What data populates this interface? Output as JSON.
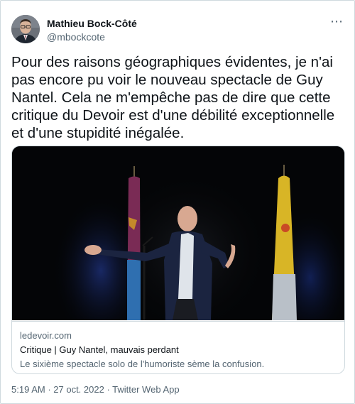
{
  "author": {
    "name": "Mathieu Bock-Côté",
    "handle": "@mbockcote"
  },
  "more_icon": "⋯",
  "tweet_text": "Pour des raisons géographiques évidentes, je n'ai pas encore pu voir le nouveau spectacle de Guy Nantel. Cela ne m'empêche pas de dire que cette critique du Devoir est d'une débilité exceptionnelle et d'une stupidité inégalée.",
  "card": {
    "domain": "ledevoir.com",
    "title": "Critique | Guy Nantel, mauvais perdant",
    "description": "Le sixième spectacle solo de l'humoriste sème la confusion."
  },
  "meta": {
    "time": "5:19 AM",
    "separator1": " · ",
    "date": "27 oct. 2022",
    "separator2": " · ",
    "source": "Twitter Web App"
  },
  "colors": {
    "text": "#0f1419",
    "secondary": "#536471",
    "border": "#cfd9de"
  }
}
